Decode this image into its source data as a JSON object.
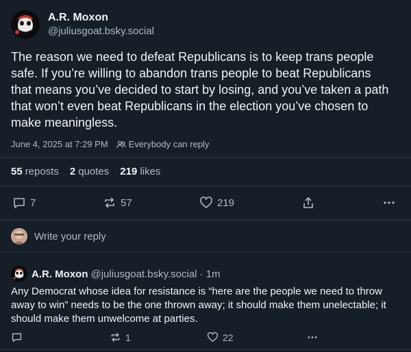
{
  "post": {
    "author": {
      "display_name": "A.R. Moxon",
      "handle": "@juliusgoat.bsky.social"
    },
    "text": "The reason we need to defeat Republicans is to keep trans people safe. If you’re willing to abandon trans people to beat Republicans that means you’ve decided to start by losing, and you’ve taken a path that won’t even beat Republicans in the election you’ve chosen to make meaningless.",
    "timestamp": "June 4, 2025 at 7:29 PM",
    "reply_permission": "Everybody can reply",
    "stats": {
      "reposts_count": "55",
      "reposts_label": "reposts",
      "quotes_count": "2",
      "quotes_label": "quotes",
      "likes_count": "219",
      "likes_label": "likes"
    },
    "actions": {
      "reply_count": "7",
      "repost_count": "57",
      "like_count": "219"
    }
  },
  "compose": {
    "placeholder": "Write your reply"
  },
  "reply": {
    "display_name": "A.R. Moxon",
    "handle": "@juliusgoat.bsky.social",
    "time": "· 1m",
    "text": "Any Democrat whose idea for resistance is “here are the people we need to throw away to win” needs to be the one thrown away; it should make them unelectable; it should make them unwelcome at parties.",
    "actions": {
      "reply_count": "",
      "repost_count": "1",
      "like_count": "22"
    }
  },
  "icons": [
    "reply-icon",
    "repost-icon",
    "like-icon",
    "share-icon",
    "more-icon",
    "people-icon"
  ],
  "colors": {
    "background": "#161e27",
    "text": "#f1f3f5",
    "muted": "#aebbc9",
    "divider": "#2e3a47"
  }
}
